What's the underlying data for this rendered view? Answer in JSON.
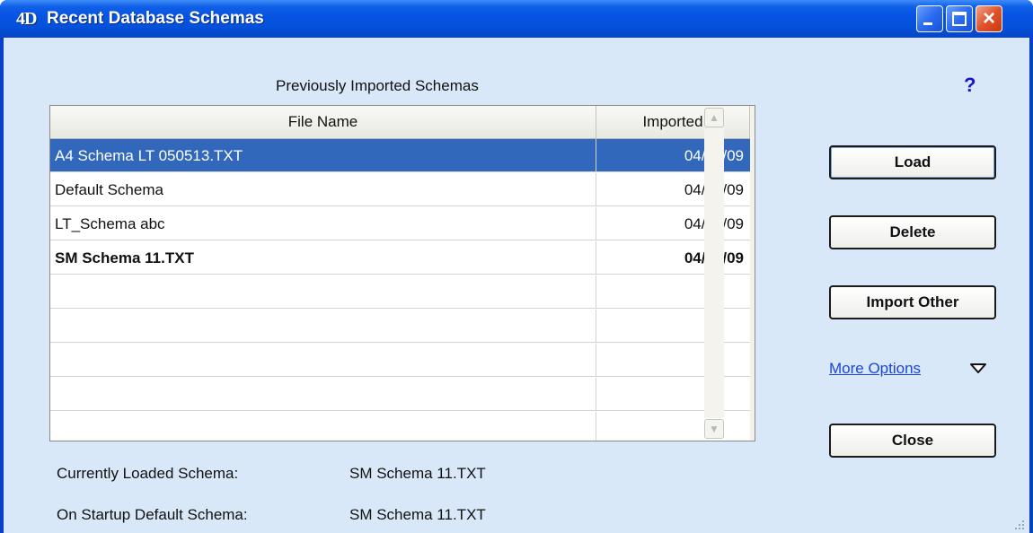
{
  "window": {
    "app_icon": "4D",
    "title": "Recent Database Schemas",
    "close_glyph": "×"
  },
  "section": {
    "title": "Previously Imported Schemas",
    "help": "?"
  },
  "table": {
    "columns": [
      "File Name",
      "Imported"
    ],
    "rows": [
      {
        "name": "A4 Schema LT 050513.TXT",
        "date": "04/28/09"
      },
      {
        "name": "Default Schema",
        "date": "04/27/09"
      },
      {
        "name": "LT_Schema abc",
        "date": "04/20/09"
      },
      {
        "name": "SM Schema 11.TXT",
        "date": "04/27/09"
      },
      {
        "name": "",
        "date": ""
      },
      {
        "name": "",
        "date": ""
      },
      {
        "name": "",
        "date": ""
      },
      {
        "name": "",
        "date": ""
      },
      {
        "name": "",
        "date": ""
      }
    ]
  },
  "buttons": {
    "load": "Load",
    "delete": "Delete",
    "import_other": "Import Other",
    "close": "Close"
  },
  "more_options": "More Options",
  "info": {
    "current_label": "Currently Loaded Schema:",
    "current_value": "SM Schema 11.TXT",
    "startup_label": "On Startup Default Schema:",
    "startup_value": "SM Schema 11.TXT"
  },
  "colors": {
    "titlebar": "#0553e0",
    "client": "#d9e8f8",
    "selection": "#3268bc",
    "link": "#1a45d6"
  }
}
